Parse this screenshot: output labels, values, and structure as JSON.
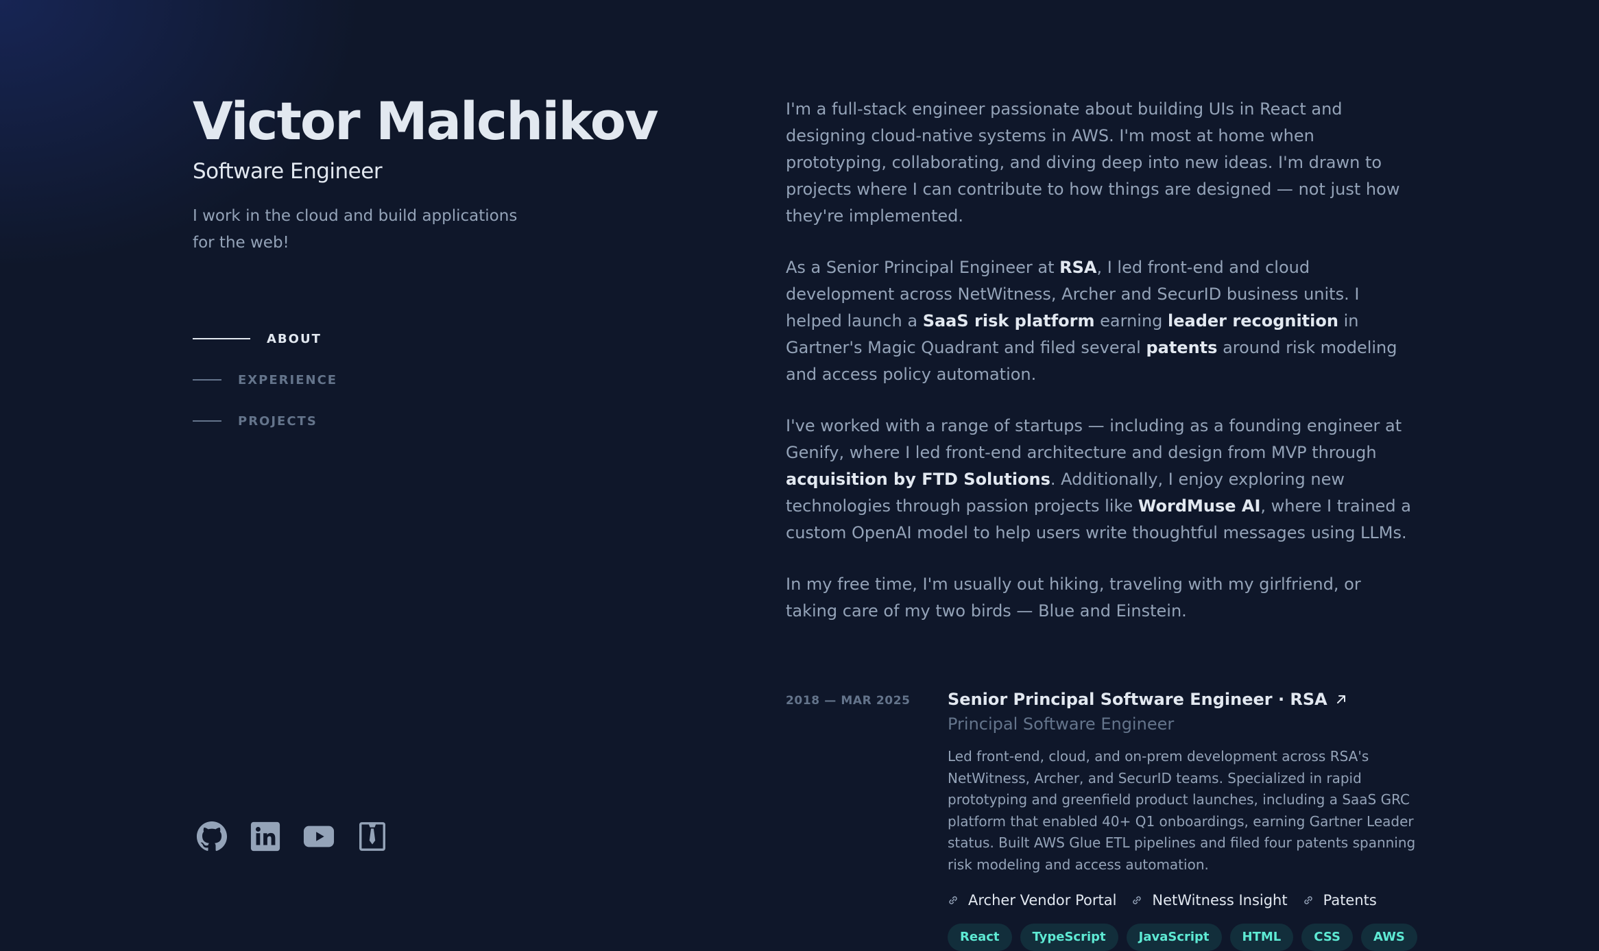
{
  "header": {
    "name": "Victor Malchikov",
    "role": "Software Engineer",
    "tagline": "I work in the cloud and build applications for the web!"
  },
  "nav": {
    "items": [
      {
        "label": "ABOUT",
        "active": true
      },
      {
        "label": "EXPERIENCE",
        "active": false
      },
      {
        "label": "PROJECTS",
        "active": false
      }
    ]
  },
  "socials": [
    "github-icon",
    "linkedin-icon",
    "youtube-icon",
    "resume-icon"
  ],
  "about": {
    "p1": "I'm a full-stack engineer passionate about building UIs in React and designing cloud-native systems in AWS. I'm most at home when prototyping, collaborating, and diving deep into new ideas. I'm drawn to projects where I can contribute to how things are designed — not just how they're implemented.",
    "p2": {
      "t1": "As a Senior Principal Engineer at ",
      "h1": "RSA",
      "t2": ", I led front-end and cloud development across NetWitness, Archer and SecurID business units. I helped launch a ",
      "h2": "SaaS risk platform",
      "t3": " earning ",
      "h3": "leader recognition",
      "t4": " in Gartner's Magic Quadrant and filed several ",
      "h4": "patents",
      "t5": " around risk modeling and access policy automation."
    },
    "p3": {
      "t1": "I've worked with a range of startups — including as a founding engineer at Genify, where I led front-end architecture and design from MVP through ",
      "h1": "acquisition by FTD Solutions",
      "t2": ". Additionally, I enjoy exploring new technologies through passion projects like ",
      "h2": "WordMuse AI",
      "t3": ", where I trained a custom OpenAI model to help users write thoughtful messages using LLMs."
    },
    "p4": "In my free time, I'm usually out hiking, traveling with my girlfriend, or taking care of my two birds — Blue and Einstein."
  },
  "experience": {
    "date": "2018 — MAR 2025",
    "title": "Senior Principal Software Engineer · RSA",
    "subtitle": "Principal Software Engineer",
    "description": "Led front-end, cloud, and on-prem development across RSA's NetWitness, Archer, and SecurID teams. Specialized in rapid prototyping and greenfield product launches, including a SaaS GRC platform that enabled 40+ Q1 onboardings, earning Gartner Leader status. Built AWS Glue ETL pipelines and filed four patents spanning risk modeling and access automation.",
    "links": [
      "Archer Vendor Portal",
      "NetWitness Insight",
      "Patents"
    ],
    "tags": [
      "React",
      "TypeScript",
      "JavaScript",
      "HTML",
      "CSS",
      "AWS"
    ]
  },
  "colors": {
    "background": "#0f172a",
    "text_primary": "#e2e8f0",
    "text_secondary": "#94a3b8",
    "text_muted": "#64748b",
    "tag_text": "#5eead4"
  }
}
